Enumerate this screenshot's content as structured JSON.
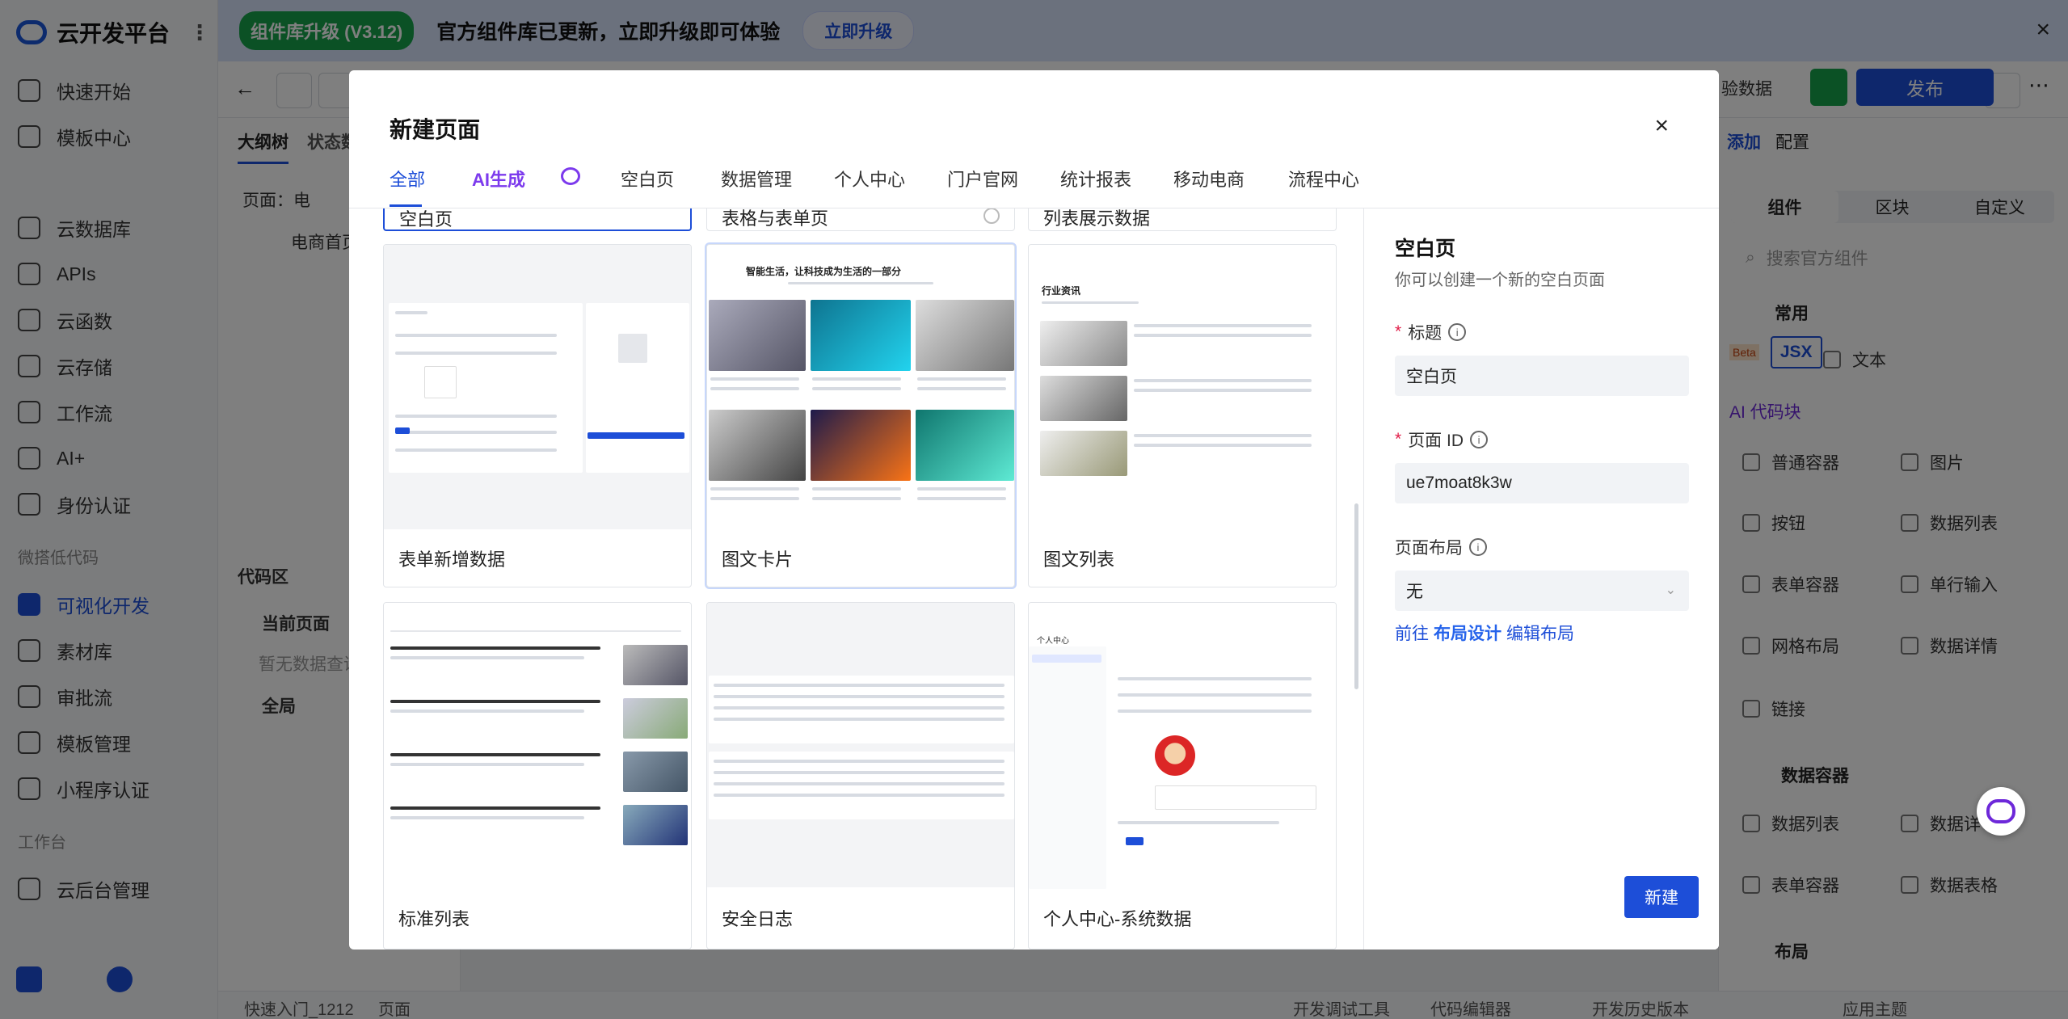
{
  "sidebar": {
    "logo": "云开发平台",
    "items": [
      {
        "label": "快速开始"
      },
      {
        "label": "模板中心"
      },
      {
        "label": "云数据库"
      },
      {
        "label": "APIs"
      },
      {
        "label": "云函数"
      },
      {
        "label": "云存储"
      },
      {
        "label": "工作流"
      },
      {
        "label": "AI+"
      },
      {
        "label": "身份认证"
      },
      {
        "label": "可视化开发"
      },
      {
        "label": "素材库"
      },
      {
        "label": "审批流"
      },
      {
        "label": "模板管理"
      },
      {
        "label": "小程序认证"
      },
      {
        "label": "云后台管理"
      }
    ],
    "groups": [
      "微搭低代码",
      "工作台"
    ]
  },
  "banner": {
    "badge": "组件库升级 (V3.12)",
    "text": "官方组件库已更新，立即升级即可体验",
    "button": "立即升级",
    "close": "×"
  },
  "editor": {
    "data_select": "验数据",
    "publish": "发布",
    "left_tabs": [
      "大纲树",
      "状态数"
    ],
    "tree_page": "页面：电",
    "tree_sub": "电商首页",
    "code_section": "代码区",
    "current_page": "当前页面",
    "no_data": "暂无数据查询",
    "global": "全局",
    "right_tabs": [
      "添加",
      "配置"
    ],
    "segments": [
      "组件",
      "区块",
      "自定义"
    ],
    "search_placeholder": "搜索官方组件",
    "group_common": "常用",
    "group_data": "数据容器",
    "group_layout": "布局",
    "jsx_beta": "Beta",
    "jsx_label": "JSX",
    "ai_code": "AI 代码块",
    "components": [
      "文本",
      "普通容器",
      "图片",
      "按钮",
      "数据列表",
      "表单容器",
      "单行输入",
      "网格布局",
      "数据详情",
      "链接",
      "数据列表",
      "数据详",
      "表单容器",
      "数据表格"
    ],
    "statusbar": {
      "breadcrumb1": "快速入门_1212",
      "breadcrumb2": "页面",
      "tool1": "开发调试工具",
      "tool2": "代码编辑器",
      "tool3": "开发历史版本",
      "tool4": "应用主题"
    }
  },
  "modal": {
    "title": "新建页面",
    "close": "×",
    "tabs": [
      "全部",
      "AI生成",
      "空白页",
      "数据管理",
      "个人中心",
      "门户官网",
      "统计报表",
      "移动电商",
      "流程中心"
    ],
    "cards_top": [
      "空白页",
      "表格与表单页",
      "列表展示数据"
    ],
    "cards": [
      "表单新增数据",
      "图文卡片",
      "图文列表",
      "标准列表",
      "安全日志",
      "个人中心-系统数据"
    ],
    "preview_card_title": "智能生活，让科技成为生活的一部分",
    "preview_list_title": "行业资讯",
    "preview_profile_title": "个人中心",
    "detail": {
      "title": "空白页",
      "desc": "你可以创建一个新的空白页面",
      "title_label": "标题",
      "title_value": "空白页",
      "id_label": "页面 ID",
      "id_value": "ue7moat8k3w",
      "layout_label": "页面布局",
      "layout_value": "无",
      "link_prefix": "前往",
      "link_design": "布局设计",
      "link_edit": "编辑布局",
      "create": "新建"
    }
  }
}
